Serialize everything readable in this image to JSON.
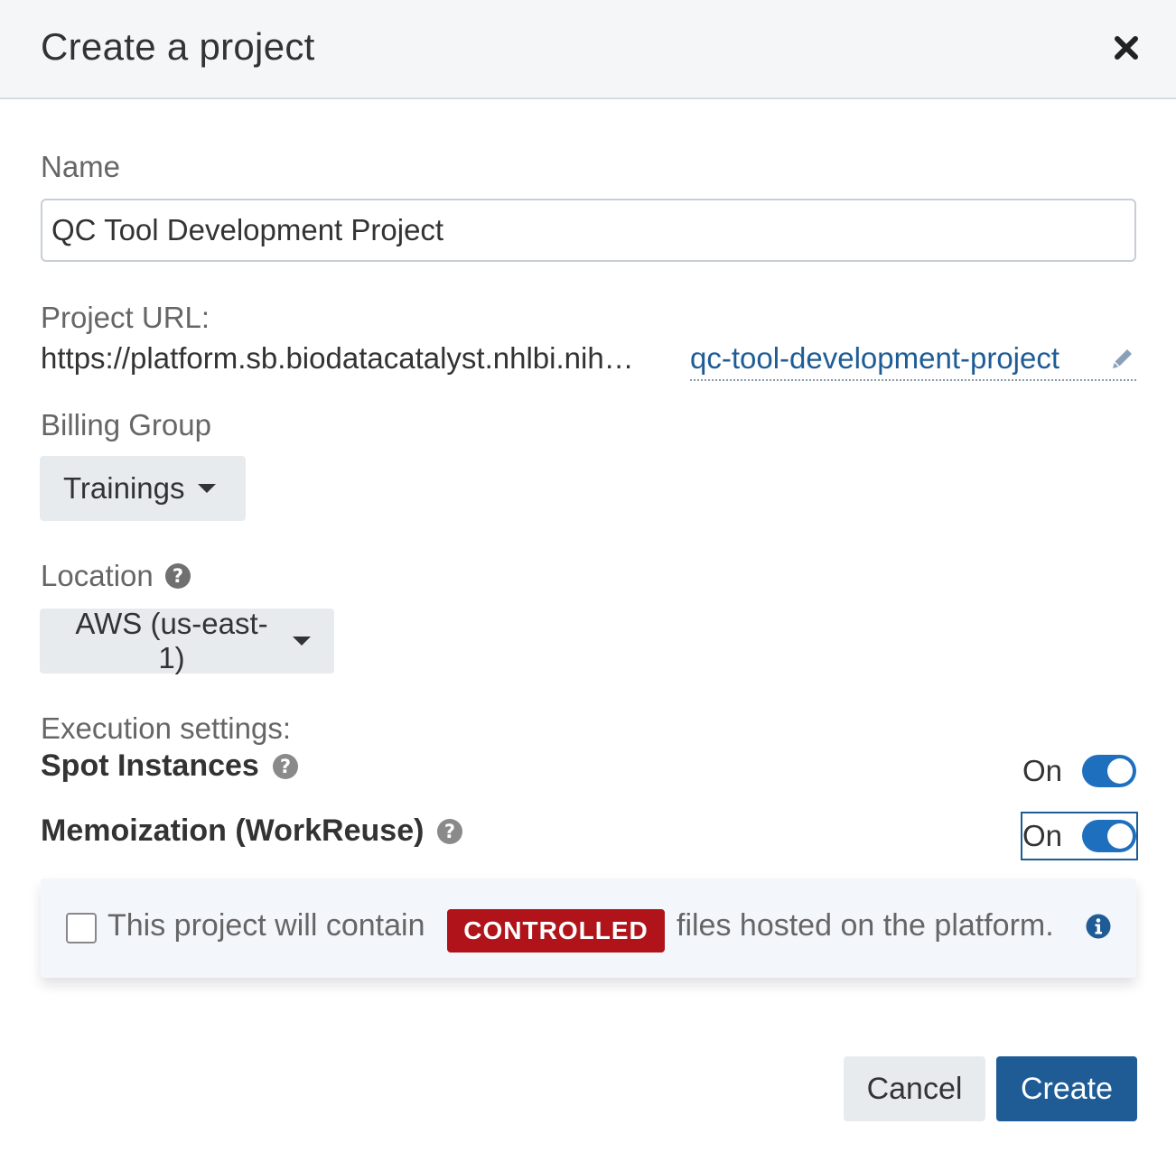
{
  "dialog": {
    "title": "Create a project"
  },
  "name": {
    "label": "Name",
    "value": "QC Tool Development Project"
  },
  "project_url": {
    "label": "Project URL:",
    "base": "https://platform.sb.biodatacatalyst.nhlbi.nih…",
    "slug": "qc-tool-development-project"
  },
  "billing_group": {
    "label": "Billing Group",
    "selected": "Trainings"
  },
  "location": {
    "label": "Location",
    "selected": "AWS (us-east-1)"
  },
  "execution": {
    "label": "Execution settings:",
    "spot_instances": {
      "label": "Spot Instances",
      "state": "On",
      "enabled": true
    },
    "memoization": {
      "label": "Memoization (WorkReuse)",
      "state": "On",
      "enabled": true
    }
  },
  "controlled": {
    "text_before": "This project will contain",
    "badge": "CONTROLLED",
    "text_after": "files hosted on the platform.",
    "checked": false
  },
  "buttons": {
    "cancel": "Cancel",
    "create": "Create"
  },
  "colors": {
    "primary": "#1f5c96",
    "toggle": "#1f6fbf",
    "badge": "#b0141a",
    "header_bg": "#f5f6f7"
  },
  "icons": {
    "close": "close-icon",
    "edit": "pencil-icon",
    "help": "question-circle-icon",
    "info": "info-circle-icon",
    "caret": "caret-down-icon"
  }
}
